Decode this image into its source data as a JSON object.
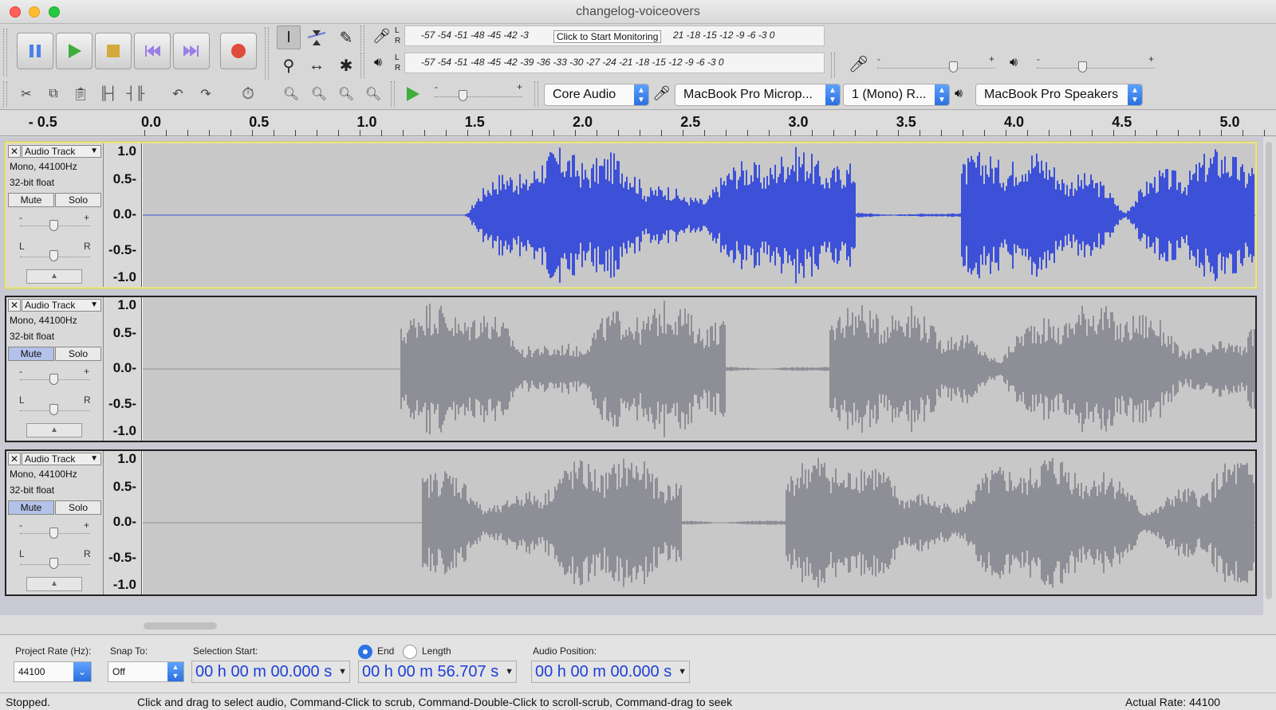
{
  "window": {
    "title": "changelog-voiceovers"
  },
  "meters": {
    "record_scale": "-57 -54 -51 -48 -45 -42 -3",
    "record_scale_tail": "21 -18 -15 -12  -9  -6  -3  0",
    "tooltip": "Click to Start Monitoring",
    "play_scale": "-57 -54 -51 -48 -45 -42 -39 -36 -33 -30 -27 -24 -21 -18 -15 -12  -9  -6  -3  0",
    "lr_l": "L",
    "lr_r": "R"
  },
  "device": {
    "host": "Core Audio",
    "input": "MacBook Pro Microp...",
    "channels": "1 (Mono) R...",
    "output": "MacBook Pro Speakers"
  },
  "ruler": {
    "labels": [
      "- 0.5",
      "0.0",
      "0.5",
      "1.0",
      "1.5",
      "2.0",
      "2.5",
      "3.0",
      "3.5",
      "4.0",
      "4.5",
      "5.0"
    ]
  },
  "tracks": [
    {
      "name": "Audio Track",
      "format": "Mono, 44100Hz",
      "bits": "32-bit float",
      "mute": "Mute",
      "solo": "Solo",
      "muted": false,
      "selected": true,
      "color": "#3c50d8",
      "start": 0.0
    },
    {
      "name": "Audio Track",
      "format": "Mono, 44100Hz",
      "bits": "32-bit float",
      "mute": "Mute",
      "solo": "Solo",
      "muted": true,
      "selected": false,
      "color": "#8e8e96",
      "start": -0.3
    },
    {
      "name": "Audio Track",
      "format": "Mono, 44100Hz",
      "bits": "32-bit float",
      "mute": "Mute",
      "solo": "Solo",
      "muted": true,
      "selected": false,
      "color": "#8e8e96",
      "start": -0.2
    }
  ],
  "vruler_labels": [
    "1.0",
    "0.5-",
    "0.0-",
    "-0.5-",
    "-1.0"
  ],
  "gain": {
    "minus": "-",
    "plus": "+",
    "left": "L",
    "right": "R"
  },
  "selection": {
    "project_rate_label": "Project Rate (Hz):",
    "project_rate": "44100",
    "snap_label": "Snap To:",
    "snap": "Off",
    "start_label": "Selection Start:",
    "start_time": "00 h 00 m 00.000 s",
    "end_label": "End",
    "length_label": "Length",
    "end_time": "00 h 00 m 56.707 s",
    "position_label": "Audio Position:",
    "position_time": "00 h 00 m 00.000 s"
  },
  "status": {
    "state": "Stopped.",
    "hint": "Click and drag to select audio, Command-Click to scrub, Command-Double-Click to scroll-scrub, Command-drag to seek",
    "rate": "Actual Rate: 44100"
  },
  "colors": {
    "accent": "#2c73e6",
    "wave_active": "#3c50d8",
    "wave_muted": "#8e8e96",
    "selected_border": "#e8e38c"
  }
}
